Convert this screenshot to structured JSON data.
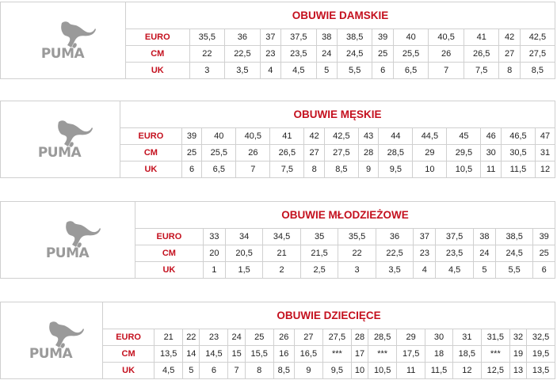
{
  "brand": {
    "logo_text": "PUMA",
    "accent_color": "#c4101e"
  },
  "tables": [
    {
      "title": "OBUWIE DAMSKIE",
      "rows": [
        {
          "label": "EURO",
          "values": [
            "35,5",
            "36",
            "37",
            "37,5",
            "38",
            "38,5",
            "39",
            "40",
            "40,5",
            "41",
            "42",
            "42,5"
          ]
        },
        {
          "label": "CM",
          "values": [
            "22",
            "22,5",
            "23",
            "23,5",
            "24",
            "24,5",
            "25",
            "25,5",
            "26",
            "26,5",
            "27",
            "27,5"
          ]
        },
        {
          "label": "UK",
          "values": [
            "3",
            "3,5",
            "4",
            "4,5",
            "5",
            "5,5",
            "6",
            "6,5",
            "7",
            "7,5",
            "8",
            "8,5"
          ]
        }
      ]
    },
    {
      "title": "OBUWIE MĘSKIE",
      "rows": [
        {
          "label": "EURO",
          "values": [
            "39",
            "40",
            "40,5",
            "41",
            "42",
            "42,5",
            "43",
            "44",
            "44,5",
            "45",
            "46",
            "46,5",
            "47"
          ]
        },
        {
          "label": "CM",
          "values": [
            "25",
            "25,5",
            "26",
            "26,5",
            "27",
            "27,5",
            "28",
            "28,5",
            "29",
            "29,5",
            "30",
            "30,5",
            "31"
          ]
        },
        {
          "label": "UK",
          "values": [
            "6",
            "6,5",
            "7",
            "7,5",
            "8",
            "8,5",
            "9",
            "9,5",
            "10",
            "10,5",
            "11",
            "11,5",
            "12"
          ]
        }
      ]
    },
    {
      "title": "OBUWIE MŁODZIEŻOWE",
      "rows": [
        {
          "label": "EURO",
          "values": [
            "33",
            "34",
            "34,5",
            "35",
            "35,5",
            "36",
            "37",
            "37,5",
            "38",
            "38,5",
            "39"
          ]
        },
        {
          "label": "CM",
          "values": [
            "20",
            "20,5",
            "21",
            "21,5",
            "22",
            "22,5",
            "23",
            "23,5",
            "24",
            "24,5",
            "25"
          ]
        },
        {
          "label": "UK",
          "values": [
            "1",
            "1,5",
            "2",
            "2,5",
            "3",
            "3,5",
            "4",
            "4,5",
            "5",
            "5,5",
            "6"
          ]
        }
      ]
    },
    {
      "title": "OBUWIE DZIECIĘCE",
      "rows": [
        {
          "label": "EURO",
          "values": [
            "21",
            "22",
            "23",
            "24",
            "25",
            "26",
            "27",
            "27,5",
            "28",
            "28,5",
            "29",
            "30",
            "31",
            "31,5",
            "32",
            "32,5"
          ]
        },
        {
          "label": "CM",
          "values": [
            "13,5",
            "14",
            "14,5",
            "15",
            "15,5",
            "16",
            "16,5",
            "***",
            "17",
            "***",
            "17,5",
            "18",
            "18,5",
            "***",
            "19",
            "19,5"
          ]
        },
        {
          "label": "UK",
          "values": [
            "4,5",
            "5",
            "6",
            "7",
            "8",
            "8,5",
            "9",
            "9,5",
            "10",
            "10,5",
            "11",
            "11,5",
            "12",
            "12,5",
            "13",
            "13,5"
          ]
        }
      ]
    }
  ]
}
